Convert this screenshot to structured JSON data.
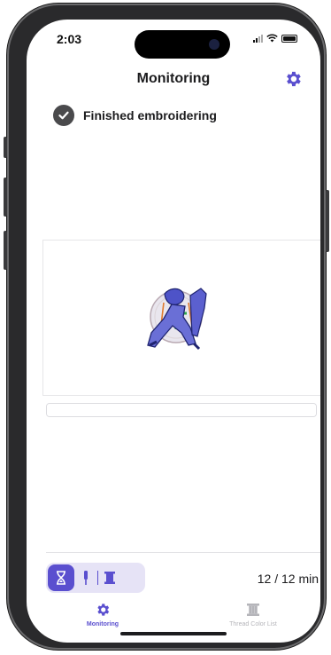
{
  "status_bar": {
    "time": "2:03"
  },
  "header": {
    "title": "Monitoring"
  },
  "status": {
    "message": "Finished embroidering"
  },
  "progress": {
    "fraction": 1.0
  },
  "footer": {
    "time_display": "12 / 12 min"
  },
  "segmented_control": {
    "items": [
      "hourglass-icon",
      "needle-icon",
      "thread-spool-icon"
    ],
    "selected_index": 0
  },
  "tabbar": {
    "tabs": [
      {
        "label": "Monitoring",
        "icon": "monitoring-gear-icon",
        "active": true
      },
      {
        "label": "Thread Color List",
        "icon": "thread-list-icon",
        "active": false
      }
    ]
  },
  "colors": {
    "accent": "#5a4fcf",
    "accent_light": "#e6e3f6",
    "check_circle": "#4a4a4c",
    "inactive_tab": "#b5b5ba"
  }
}
